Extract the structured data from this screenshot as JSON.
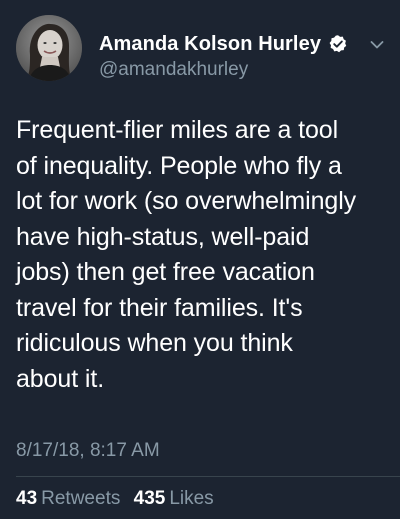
{
  "tweet": {
    "author": {
      "display_name": "Amanda Kolson Hurley",
      "handle": "@amandakhurley",
      "verified": true,
      "avatar_icon": "profile-photo",
      "verified_icon": "verified-badge-icon"
    },
    "text_lines": [
      "Frequent-flier miles are a tool",
      "of inequality. People who fly a",
      "lot for work (so overwhelmingly",
      "have high-status, well-paid",
      "jobs) then get free vacation",
      "travel for their families. It's",
      "ridiculous when you think",
      "about it."
    ],
    "timestamp": "8/17/18, 8:17 AM",
    "stats": {
      "retweets_count": "43",
      "retweets_label": "Retweets",
      "likes_count": "435",
      "likes_label": "Likes"
    }
  },
  "colors": {
    "background": "#1c2431",
    "primary_text": "#ffffff",
    "secondary_text": "#8899a6",
    "divider": "#38444d"
  }
}
